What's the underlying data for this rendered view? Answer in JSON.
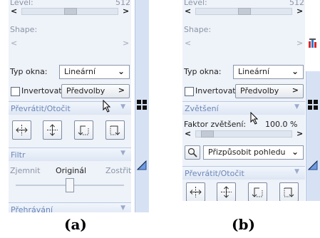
{
  "panel_a": {
    "level_label": "Level:",
    "level_value": "512",
    "shape_label": "Shape:",
    "window_type_label": "Typ okna:",
    "window_type_value": "Lineární",
    "invert_label": "Invertovat",
    "presets_label": "Předvolby",
    "flip_rotate_section": "Převrátit/Otočit",
    "filter_section": "Filtr",
    "sharpen_label": "Zjemnit",
    "original_label": "Originál",
    "sharpen_right_label": "Zostřit",
    "browse_section": "Přehrávání"
  },
  "panel_b": {
    "level_label": "Level:",
    "level_value": "512",
    "shape_label": "Shape:",
    "window_type_label": "Typ okna:",
    "window_type_value": "Lineární",
    "invert_label": "Invertovat",
    "presets_label": "Předvolby",
    "zoom_section": "Zvětšení",
    "zoom_factor_label": "Faktor zvětšení:",
    "zoom_factor_value": "100.0 %",
    "fit_view_value": "Přizpůsobit pohledu",
    "flip_rotate_section": "Převrátit/Otočit"
  },
  "captions": {
    "a": "(a)",
    "b": "(b)"
  }
}
